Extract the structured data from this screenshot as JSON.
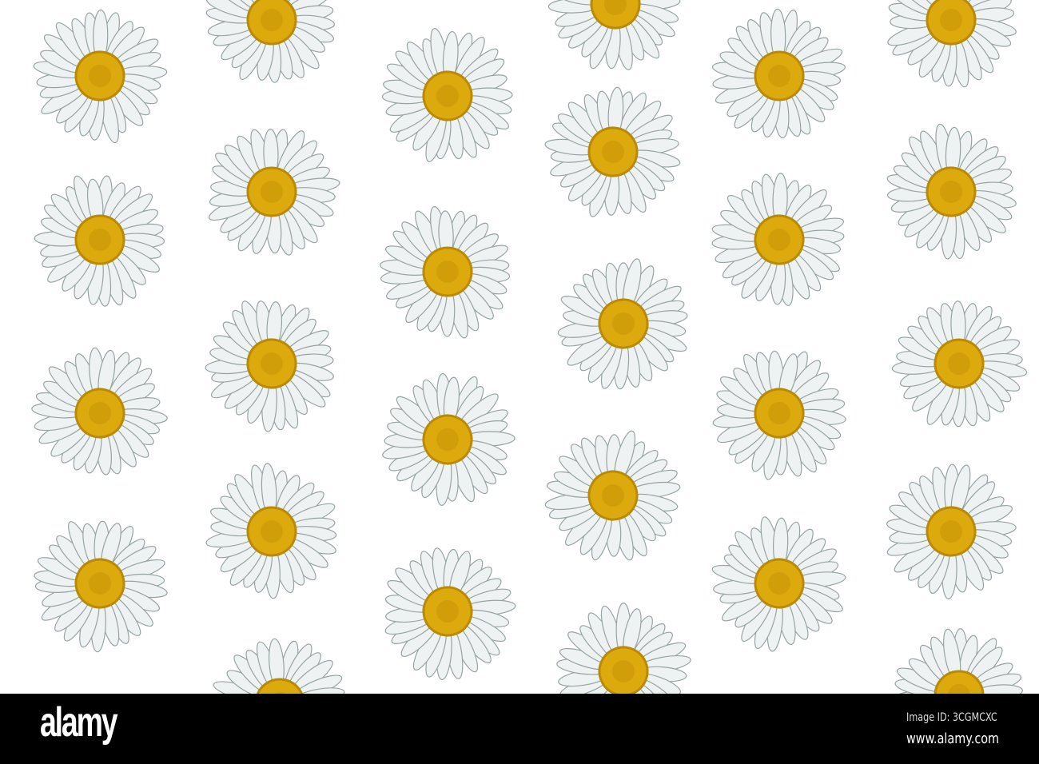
{
  "image": {
    "subject": "daisy-pattern",
    "colors": {
      "petal": "#eef2f2",
      "petal_edge": "#97a3a3",
      "center": "#dcaa0c",
      "center_dark": "#b98a05",
      "background": "#ffffff"
    }
  },
  "watermark": {
    "logo": "alamy",
    "image_id": "Image ID: 3CGMCXC",
    "site": "www.alamy.com"
  }
}
